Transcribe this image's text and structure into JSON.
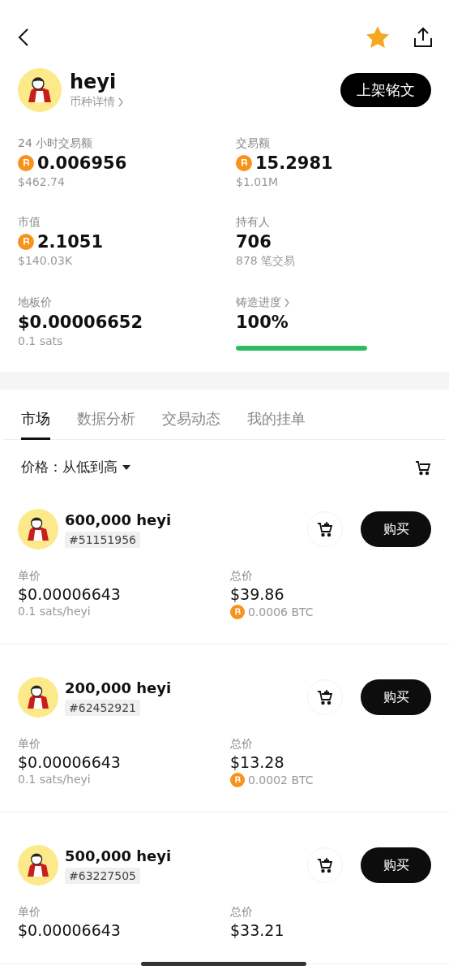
{
  "header": {
    "favorited": true
  },
  "token": {
    "name": "heyi",
    "details_link": "币种详情",
    "list_button": "上架铭文"
  },
  "stats": [
    {
      "kind": "btc",
      "label": "24 小时交易额",
      "value": "0.006956",
      "sub": "$462.74"
    },
    {
      "kind": "btc",
      "label": "交易额",
      "value": "15.2981",
      "sub": "$1.01M"
    },
    {
      "kind": "btc",
      "label": "市值",
      "value": "2.1051",
      "sub": "$140.03K"
    },
    {
      "kind": "plain",
      "label": "持有人",
      "value": "706",
      "sub": "878 笔交易"
    },
    {
      "kind": "plain",
      "label": "地板价",
      "value": "$0.00006652",
      "sub": "0.1 sats"
    },
    {
      "kind": "progress",
      "label": "铸造进度",
      "value": "100%",
      "level": 1
    }
  ],
  "tabs": [
    {
      "label": "市场",
      "selected": true
    },
    {
      "label": "数据分析",
      "selected": false
    },
    {
      "label": "交易动态",
      "selected": false
    },
    {
      "label": "我的挂单",
      "selected": false
    }
  ],
  "sort": {
    "label": "价格：",
    "value": "从低到高"
  },
  "listings": [
    {
      "amount": "600,000 heyi",
      "id": "#51151956",
      "unit_label": "单价",
      "unit_price": "$0.00006643",
      "unit_sub": "0.1 sats/heyi",
      "total_label": "总价",
      "total": "$39.86",
      "total_btc": "0.0006 BTC",
      "buy": "购买"
    },
    {
      "amount": "200,000 heyi",
      "id": "#62452921",
      "unit_label": "单价",
      "unit_price": "$0.00006643",
      "unit_sub": "0.1 sats/heyi",
      "total_label": "总价",
      "total": "$13.28",
      "total_btc": "0.0002 BTC",
      "buy": "购买"
    },
    {
      "amount": "500,000 heyi",
      "id": "#63227505",
      "unit_label": "单价",
      "unit_price": "$0.00006643",
      "total_label": "总价",
      "total": "$33.21",
      "buy": "购买"
    }
  ]
}
